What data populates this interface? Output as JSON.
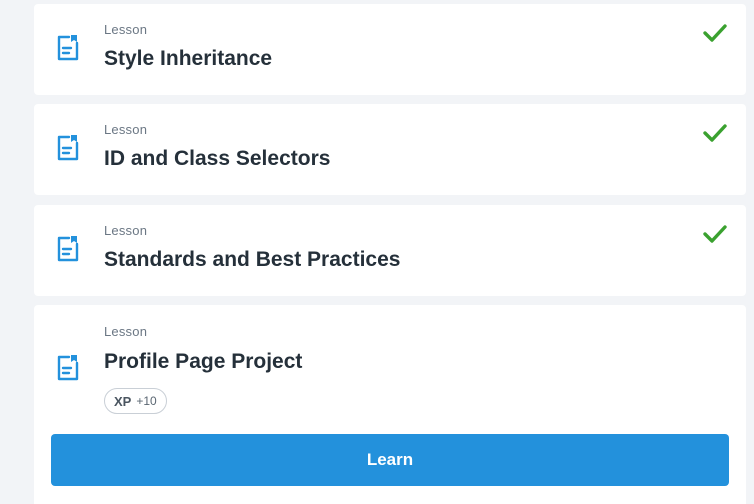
{
  "colors": {
    "background": "#f2f4f7",
    "card": "#ffffff",
    "accent": "#2391dc",
    "check": "#3aa12f"
  },
  "lessons": [
    {
      "kicker": "Lesson",
      "title": "Style Inheritance",
      "completed": true,
      "icon": "lesson-document-icon"
    },
    {
      "kicker": "Lesson",
      "title": "ID and Class Selectors",
      "completed": true,
      "icon": "lesson-document-icon"
    },
    {
      "kicker": "Lesson",
      "title": "Standards and Best Practices",
      "completed": true,
      "icon": "lesson-document-icon"
    },
    {
      "kicker": "Lesson",
      "title": "Profile Page Project",
      "completed": false,
      "icon": "lesson-document-icon",
      "xp": {
        "label": "XP",
        "value": "+10"
      },
      "action_label": "Learn"
    }
  ]
}
